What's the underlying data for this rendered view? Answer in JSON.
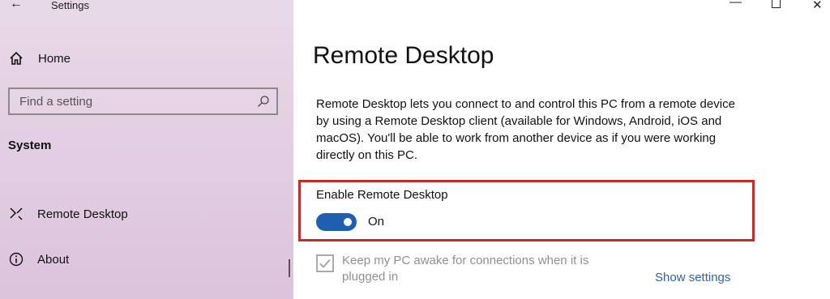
{
  "app": {
    "title": "Settings",
    "window_controls": {
      "minimize": "—",
      "close": "✕"
    }
  },
  "sidebar": {
    "home_label": "Home",
    "search_placeholder": "Find a setting",
    "section_title": "System",
    "items": [
      {
        "label": "Remote Desktop",
        "icon": "remote-desktop-icon"
      },
      {
        "label": "About",
        "icon": "info-icon"
      }
    ]
  },
  "main": {
    "title": "Remote Desktop",
    "description": "Remote Desktop lets you connect to and control this PC from a remote device by using a Remote Desktop client (available for Windows, Android, iOS and macOS). You'll be able to work from another device as if you were working directly on this PC.",
    "enable_label": "Enable Remote Desktop",
    "toggle_state": "On",
    "toggle_on": true,
    "keep_awake_label": "Keep my PC awake for connections when it is plugged in",
    "keep_awake_checked": true,
    "show_settings_link": "Show settings"
  },
  "colors": {
    "accent": "#1f5fb0",
    "highlight": "#c82a2a",
    "link": "#2a62b0"
  }
}
